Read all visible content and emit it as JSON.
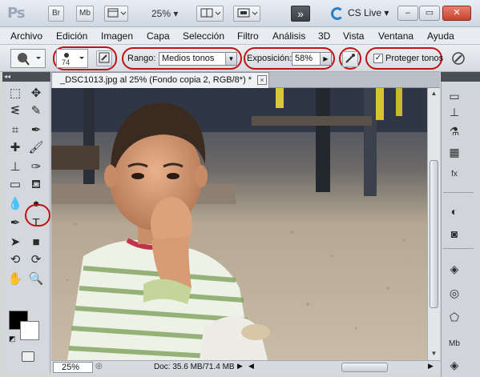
{
  "app": {
    "logo": "Ps",
    "bridge_label": "Br",
    "minibridge_label": "Mb",
    "zoom": "25%",
    "cslive_label": "CS Live"
  },
  "menu": [
    "Archivo",
    "Edición",
    "Imagen",
    "Capa",
    "Selección",
    "Filtro",
    "Análisis",
    "3D",
    "Vista",
    "Ventana",
    "Ayuda"
  ],
  "options": {
    "brush_size": "74",
    "range_label": "Rango:",
    "range_value": "Medios tonos",
    "exposure_label": "Exposición:",
    "exposure_value": "58%",
    "protect_label": "Proteger tonos",
    "protect_checked": "✓"
  },
  "document": {
    "tab_title": "_DSC1013.jpg al 25% (Fondo copia 2, RGB/8*) *",
    "close_glyph": "×"
  },
  "status": {
    "zoom": "25%",
    "doc_info": "Doc: 35.6 MB/71.4 MB"
  },
  "tools_left": [
    {
      "name": "marquee-tool-icon",
      "glyph": "⬚"
    },
    {
      "name": "move-tool-icon",
      "glyph": "✥"
    },
    {
      "name": "lasso-tool-icon",
      "glyph": "ᓬ"
    },
    {
      "name": "quick-selection-tool-icon",
      "glyph": "✎"
    },
    {
      "name": "crop-tool-icon",
      "glyph": "⌗"
    },
    {
      "name": "eyedropper-tool-icon",
      "glyph": "✒"
    },
    {
      "name": "healing-brush-tool-icon",
      "glyph": "✚"
    },
    {
      "name": "brush-tool-icon",
      "glyph": "🖌"
    },
    {
      "name": "clone-stamp-tool-icon",
      "glyph": "⊥"
    },
    {
      "name": "history-brush-tool-icon",
      "glyph": "✑"
    },
    {
      "name": "eraser-tool-icon",
      "glyph": "▭"
    },
    {
      "name": "paint-bucket-tool-icon",
      "glyph": "⛾"
    },
    {
      "name": "blur-tool-icon",
      "glyph": "💧"
    },
    {
      "name": "sponge-tool-icon",
      "glyph": "●"
    },
    {
      "name": "pen-tool-icon",
      "glyph": "✒"
    },
    {
      "name": "type-tool-icon",
      "glyph": "T"
    },
    {
      "name": "path-selection-tool-icon",
      "glyph": "➤"
    },
    {
      "name": "rectangle-tool-icon",
      "glyph": "■"
    },
    {
      "name": "3d-rotate-tool-icon",
      "glyph": "⟲"
    },
    {
      "name": "3d-orbit-tool-icon",
      "glyph": "⟳"
    },
    {
      "name": "hand-tool-icon",
      "glyph": "✋"
    },
    {
      "name": "zoom-tool-icon",
      "glyph": "🔍"
    }
  ],
  "dock_icons": [
    {
      "name": "layers-comp-icon",
      "glyph": "▭"
    },
    {
      "name": "clone-source-icon",
      "glyph": "⊥"
    },
    {
      "name": "tool-presets-icon",
      "glyph": "⚗"
    },
    {
      "name": "swatches-icon",
      "glyph": "▦"
    },
    {
      "name": "styles-icon",
      "glyph": "fx"
    },
    {
      "name": "adjustments-icon",
      "glyph": "◐"
    },
    {
      "name": "masks-icon",
      "glyph": "◙"
    },
    {
      "name": "layers-icon",
      "glyph": "◈"
    },
    {
      "name": "channels-icon",
      "glyph": "◎"
    },
    {
      "name": "paths-icon",
      "glyph": "⬠"
    },
    {
      "name": "mini-bridge-icon",
      "glyph": "Mb"
    },
    {
      "name": "color-icon",
      "glyph": "◈"
    }
  ],
  "colors": {
    "highlight_ring": "#c01212",
    "foreground": "#000000",
    "background": "#ffffff"
  }
}
